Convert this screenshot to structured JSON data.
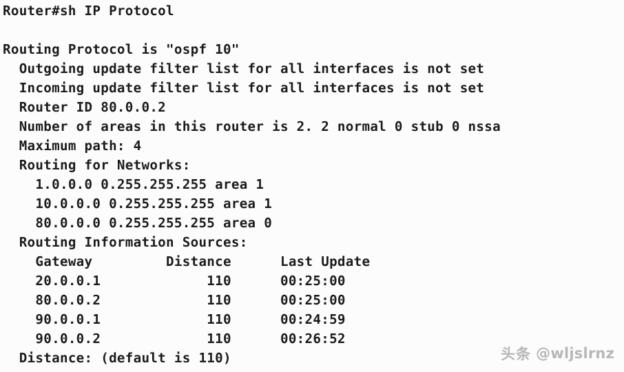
{
  "terminal": {
    "device_name": "Router",
    "prompt_symbol": "#",
    "command": "sh IP Protocol",
    "prompt_line": "Router#sh IP Protocol",
    "lines": [
      "Router#sh IP Protocol",
      "",
      "Routing Protocol is \"ospf 10\"",
      "  Outgoing update filter list for all interfaces is not set",
      "  Incoming update filter list for all interfaces is not set",
      "  Router ID 80.0.0.2",
      "  Number of areas in this router is 2. 2 normal 0 stub 0 nssa",
      "  Maximum path: 4",
      "  Routing for Networks:",
      "    1.0.0.0 0.255.255.255 area 1",
      "    10.0.0.0 0.255.255.255 area 1",
      "    80.0.0.0 0.255.255.255 area 0",
      "  Routing Information Sources:",
      "    Gateway         Distance      Last Update",
      "    20.0.0.1             110      00:25:00",
      "    80.0.0.2             110      00:25:00",
      "    90.0.0.1             110      00:24:59",
      "    90.0.0.2             110      00:26:52",
      "  Distance: (default is 110)"
    ]
  },
  "protocol": {
    "header": "Routing Protocol is \"ospf 10\"",
    "name": "ospf",
    "process_id": "10",
    "outgoing_filter": "Outgoing update filter list for all interfaces is not set",
    "incoming_filter": "Incoming update filter list for all interfaces is not set",
    "router_id_label": "Router ID",
    "router_id": "80.0.0.2",
    "router_id_line": "Router ID 80.0.0.2",
    "areas_line": "Number of areas in this router is 2. 2 normal 0 stub 0 nssa",
    "areas_total": "2",
    "areas_normal": "2",
    "areas_stub": "0",
    "areas_nssa": "0",
    "maximum_path_line": "Maximum path: 4",
    "maximum_path": "4",
    "distance_line": "Distance: (default is 110)",
    "distance_default": "110"
  },
  "networks": {
    "heading": "Routing for Networks:",
    "rows": [
      {
        "network": "1.0.0.0",
        "wildcard": "0.255.255.255",
        "area_label": "area",
        "area": "1",
        "line": "1.0.0.0 0.255.255.255 area 1"
      },
      {
        "network": "10.0.0.0",
        "wildcard": "0.255.255.255",
        "area_label": "area",
        "area": "1",
        "line": "10.0.0.0 0.255.255.255 area 1"
      },
      {
        "network": "80.0.0.0",
        "wildcard": "0.255.255.255",
        "area_label": "area",
        "area": "0",
        "line": "80.0.0.0 0.255.255.255 area 0"
      }
    ]
  },
  "information_sources": {
    "heading": "Routing Information Sources:",
    "columns": [
      "Gateway",
      "Distance",
      "Last Update"
    ],
    "header_line": "Gateway         Distance      Last Update",
    "rows": [
      {
        "gateway": "20.0.0.1",
        "distance": "110",
        "last_update": "00:25:00",
        "line": "20.0.0.1             110      00:25:00"
      },
      {
        "gateway": "80.0.0.2",
        "distance": "110",
        "last_update": "00:25:00",
        "line": "80.0.0.2             110      00:25:00"
      },
      {
        "gateway": "90.0.0.1",
        "distance": "110",
        "last_update": "00:24:59",
        "line": "90.0.0.1             110      00:24:59"
      },
      {
        "gateway": "90.0.0.2",
        "distance": "110",
        "last_update": "00:26:52",
        "line": "90.0.0.2             110      00:26:52"
      }
    ]
  },
  "watermark": {
    "platform": "头条",
    "handle": "@wljslrnz",
    "color": "#b4b4b6"
  },
  "theme": {
    "background": "#fcfcfd",
    "text": "#1b1b1b"
  }
}
